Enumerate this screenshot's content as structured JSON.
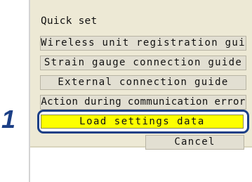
{
  "step_number": "1",
  "menu": {
    "title": "Quick set",
    "items": [
      {
        "label": "Wireless unit registration guide"
      },
      {
        "label": "Strain gauge connection guide"
      },
      {
        "label": "External connection guide"
      },
      {
        "label": "Action during communication error"
      }
    ],
    "selected_item": {
      "label": "Load settings data"
    },
    "cancel_label": "Cancel"
  },
  "colors": {
    "panel_background": "#ede9d5",
    "button_background": "#e2dfd2",
    "selected_background": "#fdff00",
    "highlight_ring": "#1b3f86",
    "step_number": "#1b3f86"
  }
}
